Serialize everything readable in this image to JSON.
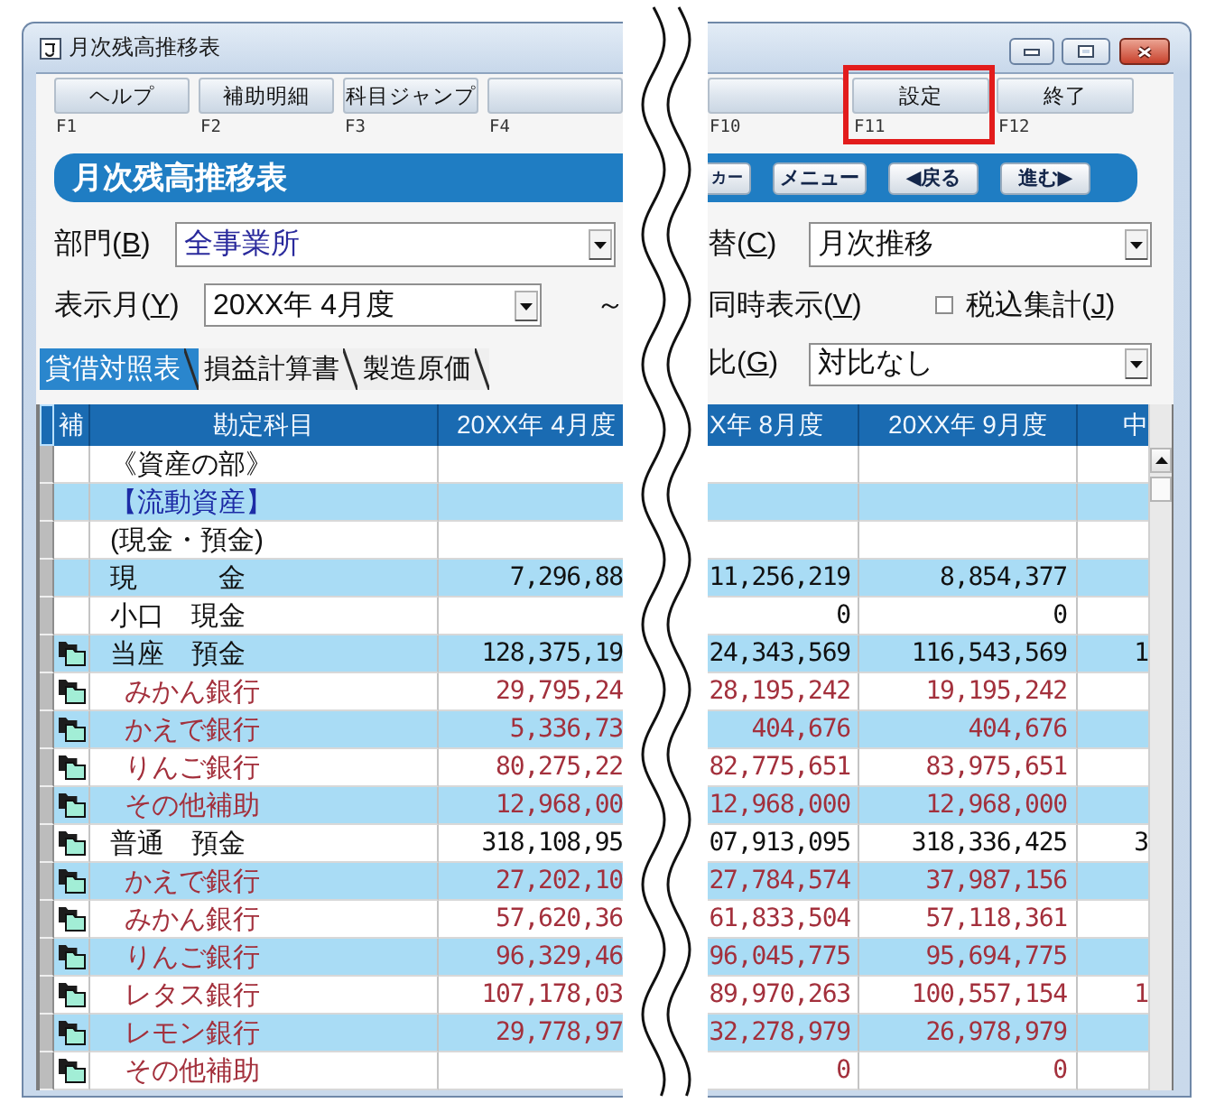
{
  "window": {
    "title": "月次残高推移表"
  },
  "function_keys": {
    "left": [
      {
        "label": "ヘルプ",
        "key": "F1",
        "highlighted": false
      },
      {
        "label": "補助明細",
        "key": "F2",
        "highlighted": false
      },
      {
        "label": "科目ジャンプ",
        "key": "F3",
        "highlighted": false
      },
      {
        "key": "F4",
        "highlighted": false
      }
    ],
    "right": [
      {
        "key": "F10",
        "highlighted": false
      },
      {
        "label": "設定",
        "key": "F11",
        "highlighted": true
      },
      {
        "label": "終了",
        "key": "F12",
        "highlighted": false
      }
    ]
  },
  "banner": {
    "title": "月次残高推移表",
    "buttons": [
      "カー",
      "メニュー",
      "◀戻る",
      "進む▶"
    ]
  },
  "filters": {
    "department": {
      "label": "部門(B)",
      "value": "全事業所",
      "focused": true
    },
    "display_month": {
      "label": "表示月(Y)",
      "value": "20XX年 4月度",
      "focused": false
    },
    "range_mark": "～",
    "view_switch": {
      "label": "替(C)",
      "value": "月次推移",
      "focused": false
    },
    "simultaneous_display": {
      "label": "同時表示(V)"
    },
    "tax_included": {
      "label": "税込集計(J)",
      "checked": false
    },
    "comparison": {
      "label": "比(G)",
      "value": "対比なし",
      "focused": false
    }
  },
  "tabs": [
    {
      "label": "貸借対照表",
      "selected": true
    },
    {
      "label": "損益計算書",
      "selected": false
    },
    {
      "label": "製造原価",
      "selected": false
    }
  ],
  "table": {
    "columns_left": [
      {
        "label": "補"
      },
      {
        "label": "勘定科目"
      },
      {
        "label": "20XX年 4月度"
      }
    ],
    "columns_right": [
      {
        "label": "X年 8月度"
      },
      {
        "label": "20XX年 9月度"
      },
      {
        "label": "中"
      }
    ],
    "rows": [
      {
        "account": "《資産の部》",
        "kind": "section",
        "sub_ledger": false
      },
      {
        "account": "【流動資産】",
        "kind": "category",
        "sub_ledger": false
      },
      {
        "account": "(現金・預金)",
        "kind": "group",
        "sub_ledger": false
      },
      {
        "account": "現　　　金",
        "kind": "account",
        "sub_ledger": false,
        "values": {
          "april": "7,296,88",
          "august": "11,256,219",
          "september": "8,854,377"
        }
      },
      {
        "account": "小口　現金",
        "kind": "account",
        "sub_ledger": false,
        "values": {
          "august": "0",
          "september": "0"
        }
      },
      {
        "account": "当座　預金",
        "kind": "account",
        "sub_ledger": true,
        "values": {
          "april": "128,375,19",
          "august": "24,343,569",
          "september": "116,543,569",
          "cut_column": "1"
        }
      },
      {
        "account": "みかん銀行",
        "kind": "sub_account",
        "sub_ledger": true,
        "values": {
          "april": "29,795,24",
          "august": "28,195,242",
          "september": "19,195,242"
        }
      },
      {
        "account": "かえで銀行",
        "kind": "sub_account",
        "sub_ledger": true,
        "values": {
          "april": "5,336,73",
          "august": "404,676",
          "september": "404,676"
        }
      },
      {
        "account": "りんご銀行",
        "kind": "sub_account",
        "sub_ledger": true,
        "values": {
          "april": "80,275,22",
          "august": "82,775,651",
          "september": "83,975,651"
        }
      },
      {
        "account": "その他補助",
        "kind": "sub_account",
        "sub_ledger": true,
        "values": {
          "april": "12,968,00",
          "august": "12,968,000",
          "september": "12,968,000"
        }
      },
      {
        "account": "普通　預金",
        "kind": "account",
        "sub_ledger": true,
        "values": {
          "april": "318,108,95",
          "august": "07,913,095",
          "september": "318,336,425",
          "cut_column": "3"
        }
      },
      {
        "account": "かえで銀行",
        "kind": "sub_account",
        "sub_ledger": true,
        "values": {
          "april": "27,202,10",
          "august": "27,784,574",
          "september": "37,987,156"
        }
      },
      {
        "account": "みかん銀行",
        "kind": "sub_account",
        "sub_ledger": true,
        "values": {
          "april": "57,620,36",
          "august": "61,833,504",
          "september": "57,118,361"
        }
      },
      {
        "account": "りんご銀行",
        "kind": "sub_account",
        "sub_ledger": true,
        "values": {
          "april": "96,329,46",
          "august": "96,045,775",
          "september": "95,694,775"
        }
      },
      {
        "account": "レタス銀行",
        "kind": "sub_account",
        "sub_ledger": true,
        "values": {
          "april": "107,178,03",
          "august": "89,970,263",
          "september": "100,557,154",
          "cut_column": "1"
        }
      },
      {
        "account": "レモン銀行",
        "kind": "sub_account",
        "sub_ledger": true,
        "values": {
          "april": "29,778,97",
          "august": "32,278,979",
          "september": "26,978,979"
        }
      },
      {
        "account": "その他補助",
        "kind": "sub_account",
        "sub_ledger": true,
        "values": {
          "august": "0",
          "september": "0"
        }
      }
    ]
  }
}
